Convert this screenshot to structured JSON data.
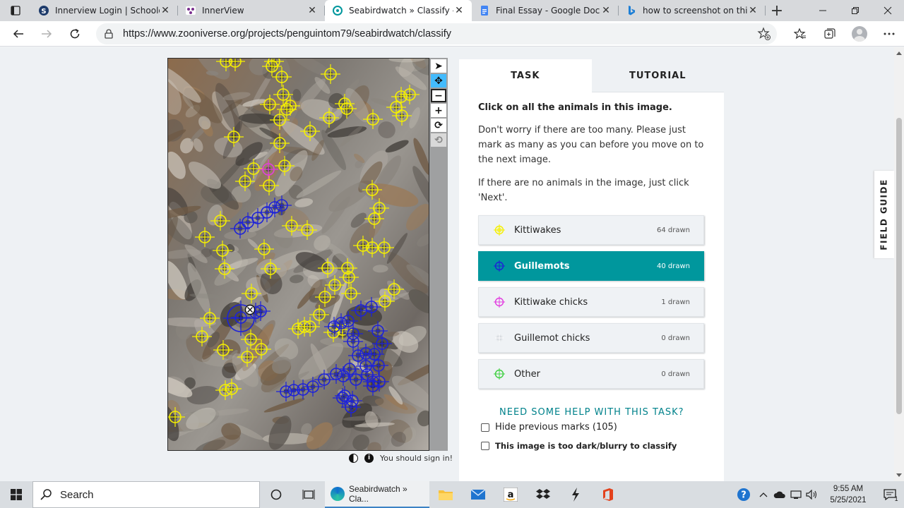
{
  "browser": {
    "tabs": [
      {
        "title": "Innerview Login | Schoology",
        "icon": "schoology-icon",
        "active": false
      },
      {
        "title": "InnerView",
        "icon": "innerview-icon",
        "active": false
      },
      {
        "title": "Seabirdwatch » Classify — Zooniverse",
        "icon": "zooniverse-icon",
        "active": true
      },
      {
        "title": "Final Essay - Google Docs",
        "icon": "google-docs-icon",
        "active": false
      },
      {
        "title": "how to screenshot on this laptop",
        "icon": "bing-icon",
        "active": false
      }
    ],
    "new_tab_label": "+",
    "url": "https://www.zooniverse.org/projects/penguintom79/seabirdwatch/classify"
  },
  "subject_tools": {
    "items": [
      {
        "name": "pointer-tool",
        "glyph": "➤"
      },
      {
        "name": "pan-tool",
        "glyph": "✥"
      },
      {
        "name": "zoom-out-tool",
        "glyph": "−"
      },
      {
        "name": "zoom-in-tool",
        "glyph": "+"
      },
      {
        "name": "rotate-tool",
        "glyph": "⟳"
      },
      {
        "name": "reset-tool",
        "glyph": "⟲"
      }
    ]
  },
  "subject_meta": {
    "sign_in_text": "You should sign in!"
  },
  "task": {
    "tab_task": "TASK",
    "tab_tutorial": "TUTORIAL",
    "question": "Click on all the animals in this image.",
    "help_1": "Don't worry if there are too many. Please just mark as many as you can before you move on to the next image.",
    "help_2": "If there are no animals in the image, just click 'Next'.",
    "answers": [
      {
        "label": "Kittiwakes",
        "count": "64 drawn",
        "color": "#f5f000",
        "selected": false
      },
      {
        "label": "Guillemots",
        "count": "40 drawn",
        "color": "#1d22d8",
        "selected": true
      },
      {
        "label": "Kittiwake chicks",
        "count": "1 drawn",
        "color": "#e23ee0",
        "selected": false
      },
      {
        "label": "Guillemot chicks",
        "count": "0 drawn",
        "color": "#d7dbe0",
        "selected": false
      },
      {
        "label": "Other",
        "count": "0 drawn",
        "color": "#41d043",
        "selected": false
      }
    ],
    "need_help": "NEED SOME HELP WITH THIS TASK?",
    "hide_marks": "Hide previous marks (105)",
    "too_dark": "This image is too dark/blurry to classify"
  },
  "field_guide": "FIELD GUIDE",
  "taskbar": {
    "search_label": "Search",
    "active_app": "Seabirdwatch » Cla...",
    "time": "9:55 AM",
    "date": "5/25/2021",
    "notification_count": "1"
  },
  "colors": {
    "teal": "#00979d",
    "kittiwake": "#f5f000",
    "guillemot": "#1d22d8",
    "kittiwake_chick": "#e23ee0",
    "other": "#41d043"
  }
}
